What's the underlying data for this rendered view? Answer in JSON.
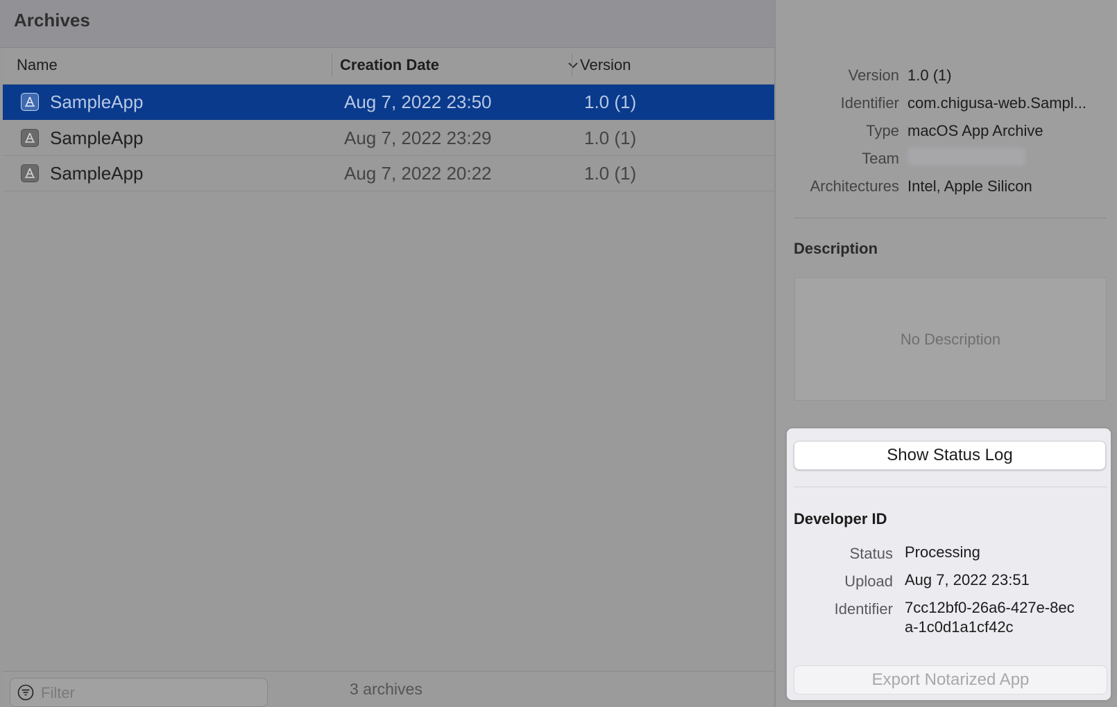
{
  "left_panel": {
    "title": "Archives",
    "columns": {
      "name": "Name",
      "creation_date": "Creation Date",
      "version": "Version"
    },
    "rows": [
      {
        "name": "SampleApp",
        "date": "Aug 7, 2022 23:50",
        "version": "1.0 (1)",
        "selected": true
      },
      {
        "name": "SampleApp",
        "date": "Aug 7, 2022 23:29",
        "version": "1.0 (1)",
        "selected": false
      },
      {
        "name": "SampleApp",
        "date": "Aug 7, 2022 20:22",
        "version": "1.0 (1)",
        "selected": false
      }
    ],
    "filter": {
      "placeholder": "Filter",
      "value": ""
    },
    "count_text": "3 archives"
  },
  "details": {
    "labels": {
      "version": "Version",
      "identifier": "Identifier",
      "type": "Type",
      "team": "Team",
      "architectures": "Architectures"
    },
    "values": {
      "version": "1.0 (1)",
      "identifier": "com.chigusa-web.Sampl...",
      "type": "macOS App Archive",
      "architectures": "Intel, Apple Silicon"
    },
    "description_title": "Description",
    "description_empty": "No Description"
  },
  "popover": {
    "show_status_log": "Show Status Log",
    "developer_id_title": "Developer ID",
    "labels": {
      "status": "Status",
      "upload": "Upload",
      "identifier": "Identifier"
    },
    "values": {
      "status": "Processing",
      "upload": "Aug 7, 2022 23:51",
      "identifier_line1": "7cc12bf0-26a6-427e-8ec",
      "identifier_line2": "a-1c0d1a1cf42c"
    },
    "export_button": "Export Notarized App"
  },
  "icons": {
    "row_icon": "app-archive-icon",
    "sort": "chevron-down-icon",
    "filter": "filter-icon"
  },
  "colors": {
    "selection": "#0a3a8c",
    "popover_bg": "#ebebf0"
  }
}
